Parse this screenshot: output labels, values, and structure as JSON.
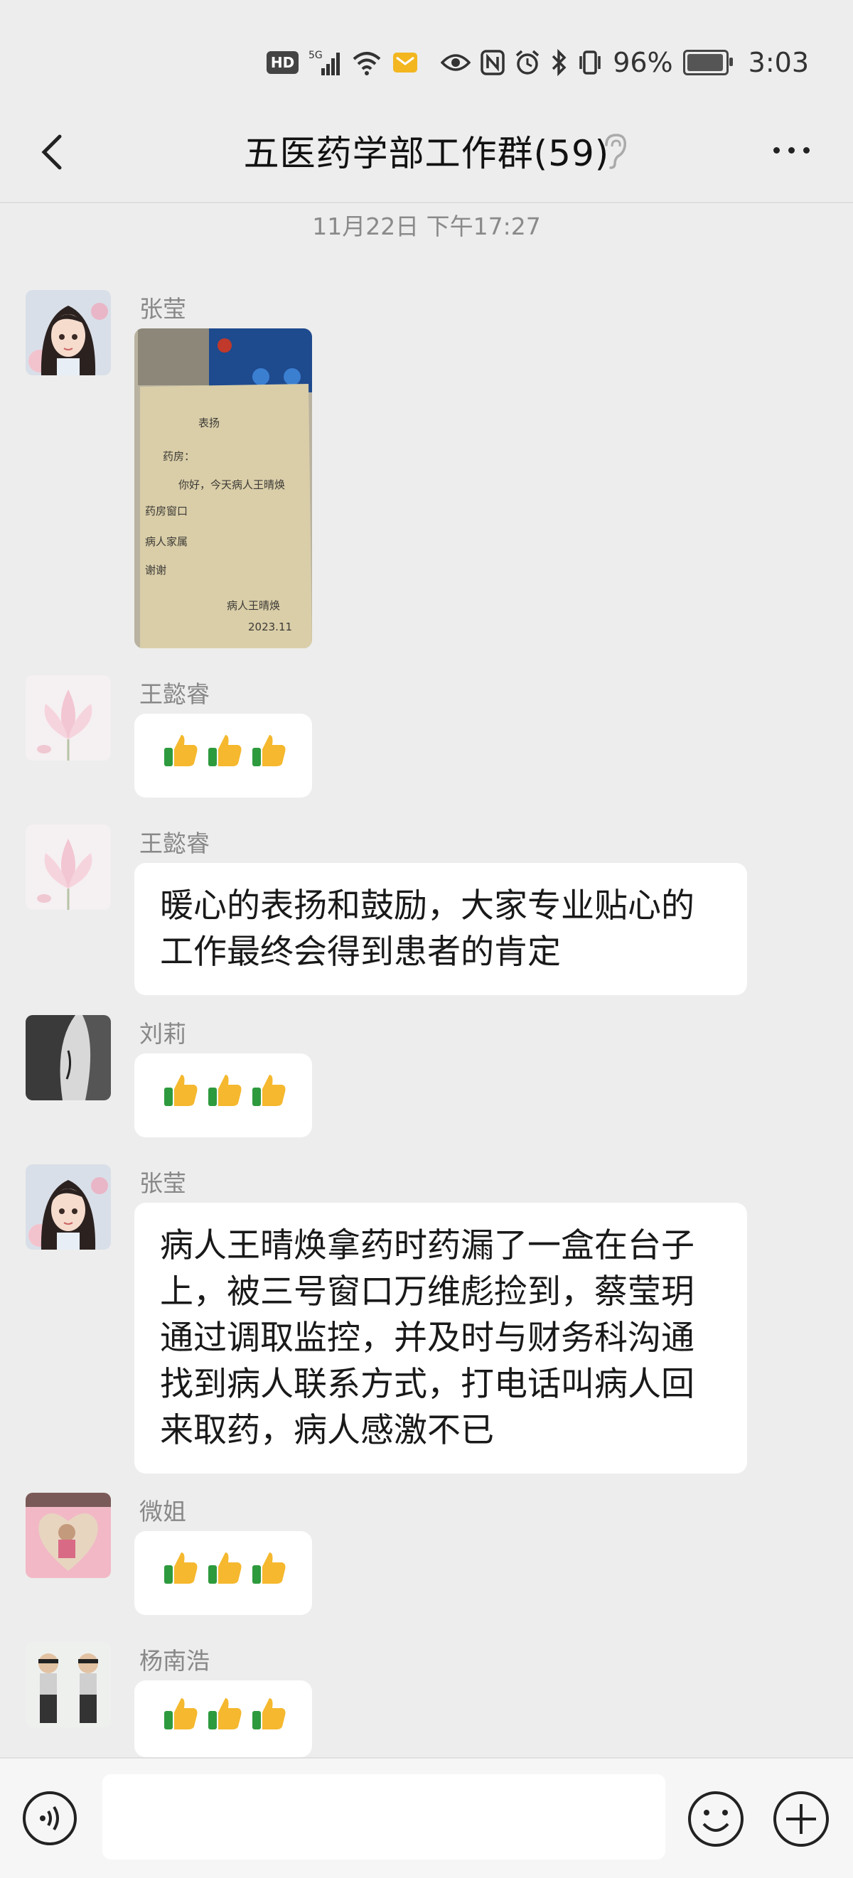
{
  "status_bar": {
    "network": "5G",
    "hd_badge": "HD",
    "battery_text": "96%",
    "battery_level": 0.96,
    "time": "3:03"
  },
  "header": {
    "title": "五医药学部工作群(59)"
  },
  "timestamp": "11月22日 下午17:27",
  "messages": [
    {
      "sender": "张莹",
      "type": "image",
      "image_text": [
        "表扬",
        "药房：",
        "你好，今天病人王晴焕",
        "药房窗口",
        "病人家属",
        "谢谢",
        "病人王晴焕",
        "2023.11"
      ]
    },
    {
      "sender": "王懿睿",
      "type": "emoji",
      "content": "👍👍👍"
    },
    {
      "sender": "王懿睿",
      "type": "text",
      "content": "暖心的表扬和鼓励，大家专业贴心的工作最终会得到患者的肯定"
    },
    {
      "sender": "刘莉",
      "type": "emoji",
      "content": "👍👍👍"
    },
    {
      "sender": "张莹",
      "type": "text",
      "content": "病人王晴焕拿药时药漏了一盒在台子上，被三号窗口万维彪捡到，蔡莹玥通过调取监控，并及时与财务科沟通找到病人联系方式，打电话叫病人回来取药，病人感激不已"
    },
    {
      "sender": "微姐",
      "type": "emoji",
      "content": "👍👍👍"
    },
    {
      "sender": "杨南浩",
      "type": "emoji",
      "content": "👍👍👍"
    }
  ],
  "input_bar": {
    "placeholder": "",
    "icons": [
      "voice-icon",
      "emoji-face-icon",
      "plus-icon"
    ]
  },
  "colors": {
    "background": "#ededed",
    "bubble": "#ffffff",
    "input_bar": "#f6f6f6"
  }
}
